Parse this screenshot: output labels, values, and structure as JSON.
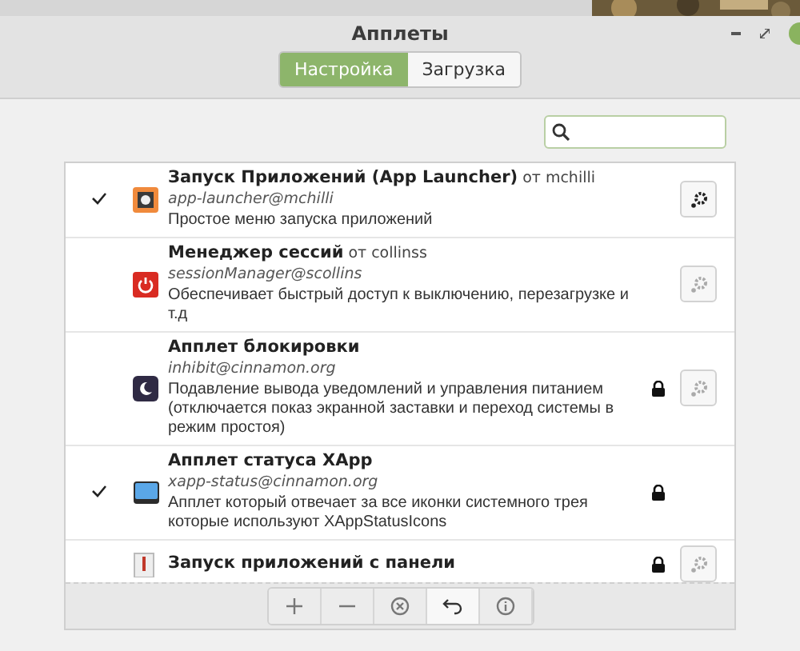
{
  "window": {
    "title": "Апплеты"
  },
  "tabs": [
    {
      "label": "Настройка",
      "selected": true
    },
    {
      "label": "Загрузка",
      "selected": false
    }
  ],
  "applets": [
    {
      "name": "Запуск Приложений (App Launcher)",
      "author": "от mchilli",
      "uuid": "app-launcher@mchilli",
      "description": "Простое меню запуска приложений",
      "checked": true,
      "locked": false,
      "has_settings": true,
      "settings_enabled": true
    },
    {
      "name": "Менеджер сессий",
      "author": "от collinss",
      "uuid": "sessionManager@scollins",
      "description": "Обеспечивает быстрый доступ к выключению, перезагрузке и т.д",
      "checked": false,
      "locked": false,
      "has_settings": true,
      "settings_enabled": false
    },
    {
      "name": "Апплет блокировки",
      "uuid": "inhibit@cinnamon.org",
      "description": "Подавление вывода уведомлений и управления питанием (отключается показ экранной заставки и переход системы в режим простоя)",
      "checked": false,
      "locked": true,
      "has_settings": true,
      "settings_enabled": false
    },
    {
      "name": "Апплет статуса XApp",
      "uuid": "xapp-status@cinnamon.org",
      "description": "Апплет который отвечает за все иконки системного трея которые используют XAppStatusIcons",
      "checked": true,
      "locked": true,
      "has_settings": false
    },
    {
      "name": "Запуск приложений с панели",
      "checked": false,
      "locked": true,
      "has_settings": true,
      "settings_enabled": false
    }
  ],
  "toolbar": [
    {
      "kind": "add"
    },
    {
      "kind": "remove"
    },
    {
      "kind": "clear"
    },
    {
      "kind": "undo"
    },
    {
      "kind": "info"
    }
  ]
}
